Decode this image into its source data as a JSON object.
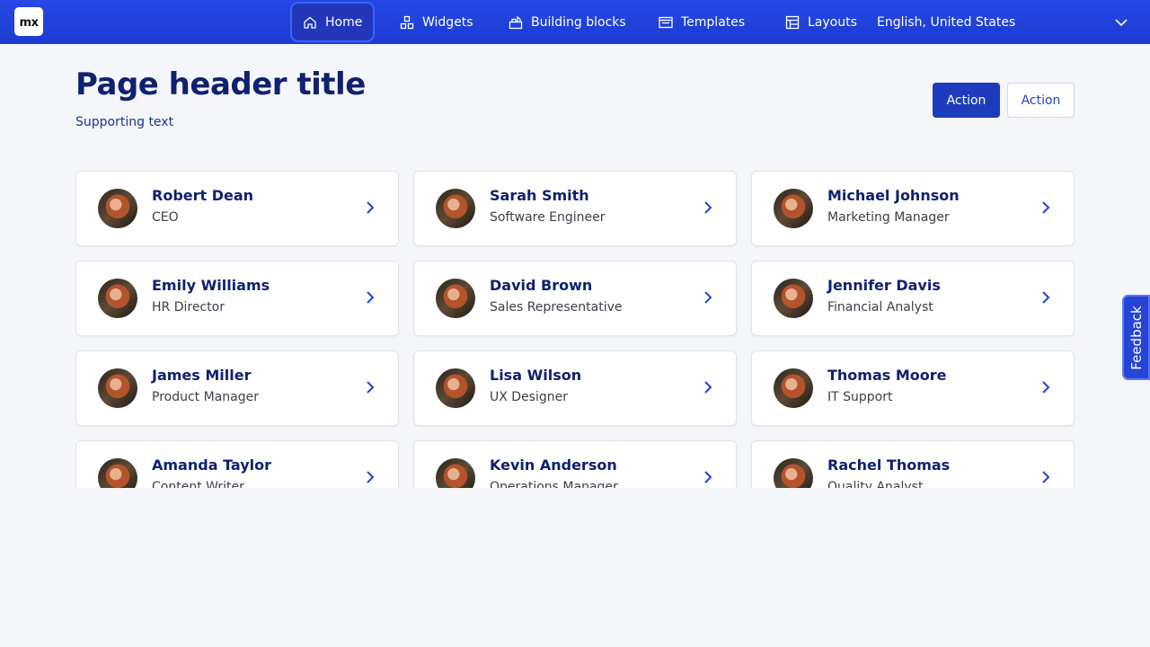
{
  "app": {
    "logo_text": "mx",
    "brand_color": "#1f3fd6"
  },
  "nav": {
    "items": [
      {
        "label": "Home",
        "icon": "home-icon",
        "active": true
      },
      {
        "label": "Widgets",
        "icon": "widgets-icon",
        "active": false
      },
      {
        "label": "Building blocks",
        "icon": "building-blocks-icon",
        "active": false
      },
      {
        "label": "Templates",
        "icon": "templates-icon",
        "active": false
      },
      {
        "label": "Layouts",
        "icon": "layouts-icon",
        "active": false
      }
    ],
    "language": "English, United States"
  },
  "header": {
    "title": "Page header title",
    "subtitle": "Supporting text",
    "primary_action": "Action",
    "secondary_action": "Action"
  },
  "people": [
    {
      "name": "Robert Dean",
      "role": "CEO"
    },
    {
      "name": "Sarah Smith",
      "role": "Software Engineer"
    },
    {
      "name": "Michael Johnson",
      "role": "Marketing Manager"
    },
    {
      "name": "Emily Williams",
      "role": "HR Director"
    },
    {
      "name": "David Brown",
      "role": "Sales Representative"
    },
    {
      "name": "Jennifer Davis",
      "role": "Financial Analyst"
    },
    {
      "name": "James Miller",
      "role": "Product Manager"
    },
    {
      "name": "Lisa Wilson",
      "role": "UX Designer"
    },
    {
      "name": "Thomas Moore",
      "role": "IT Support"
    },
    {
      "name": "Amanda Taylor",
      "role": "Content Writer"
    },
    {
      "name": "Kevin Anderson",
      "role": "Operations Manager"
    },
    {
      "name": "Rachel Thomas",
      "role": "Quality Analyst"
    }
  ],
  "feedback": {
    "label": "Feedback"
  }
}
